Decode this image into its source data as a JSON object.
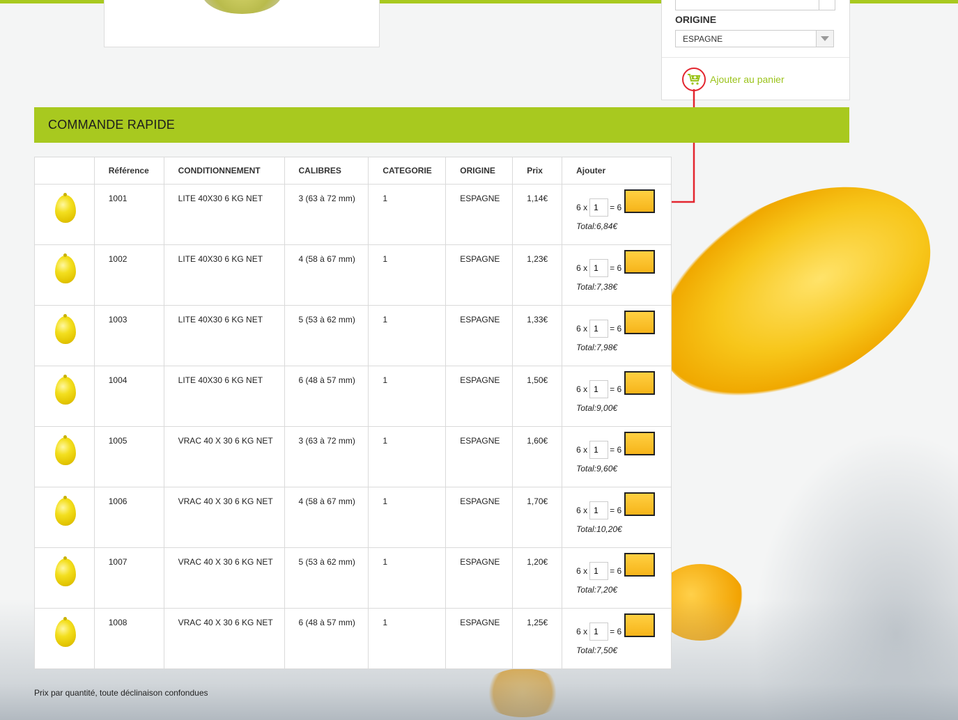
{
  "side_panel": {
    "origine_label": "ORIGINE",
    "origine_value": "ESPAGNE",
    "add_to_cart": "Ajouter au panier"
  },
  "section": {
    "title": "COMMANDE RAPIDE"
  },
  "table": {
    "headers": [
      "",
      "Référence",
      "CONDITIONNEMENT",
      "CALIBRES",
      "CATEGORIE",
      "ORIGINE",
      "Prix",
      "Ajouter"
    ],
    "rows": [
      {
        "ref": "1001",
        "cond": "LITE 40X30 6 KG NET",
        "cal": "3 (63 à 72 mm)",
        "cat": "1",
        "orig": "ESPAGNE",
        "prix": "1,14€",
        "mult": "6 x",
        "qty": "1",
        "eq": "= 6",
        "total": "Total:6,84€"
      },
      {
        "ref": "1002",
        "cond": "LITE 40X30 6 KG NET",
        "cal": "4 (58 à 67 mm)",
        "cat": "1",
        "orig": "ESPAGNE",
        "prix": "1,23€",
        "mult": "6 x",
        "qty": "1",
        "eq": "= 6",
        "total": "Total:7,38€"
      },
      {
        "ref": "1003",
        "cond": "LITE 40X30 6 KG NET",
        "cal": "5 (53 à 62 mm)",
        "cat": "1",
        "orig": "ESPAGNE",
        "prix": "1,33€",
        "mult": "6 x",
        "qty": "1",
        "eq": "= 6",
        "total": "Total:7,98€"
      },
      {
        "ref": "1004",
        "cond": "LITE 40X30 6 KG NET",
        "cal": "6 (48 à 57 mm)",
        "cat": "1",
        "orig": "ESPAGNE",
        "prix": "1,50€",
        "mult": "6 x",
        "qty": "1",
        "eq": "= 6",
        "total": "Total:9,00€"
      },
      {
        "ref": "1005",
        "cond": "VRAC 40 X 30 6 KG NET",
        "cal": "3 (63 à 72 mm)",
        "cat": "1",
        "orig": "ESPAGNE",
        "prix": "1,60€",
        "mult": "6 x",
        "qty": "1",
        "eq": "= 6",
        "total": "Total:9,60€"
      },
      {
        "ref": "1006",
        "cond": "VRAC 40 X 30 6 KG NET",
        "cal": "4 (58 à 67 mm)",
        "cat": "1",
        "orig": "ESPAGNE",
        "prix": "1,70€",
        "mult": "6 x",
        "qty": "1",
        "eq": "= 6",
        "total": "Total:10,20€"
      },
      {
        "ref": "1007",
        "cond": "VRAC 40 X 30 6 KG NET",
        "cal": "5 (53 à 62 mm)",
        "cat": "1",
        "orig": "ESPAGNE",
        "prix": "1,20€",
        "mult": "6 x",
        "qty": "1",
        "eq": "= 6",
        "total": "Total:7,20€"
      },
      {
        "ref": "1008",
        "cond": "VRAC 40 X 30 6 KG NET",
        "cal": "6 (48 à 57 mm)",
        "cat": "1",
        "orig": "ESPAGNE",
        "prix": "1,25€",
        "mult": "6 x",
        "qty": "1",
        "eq": "= 6",
        "total": "Total:7,50€"
      }
    ]
  },
  "footnote": "Prix par quantité, toute déclinaison confondues",
  "colors": {
    "accent_green": "#a8c91f",
    "link_green": "#9bc31b",
    "button_yellow": "#f6b41a",
    "annotation_red": "#e3262f"
  },
  "icons": {
    "cart": "cart-plus-icon",
    "row_image": "lemon-icon",
    "dropdown": "chevron-down-icon"
  }
}
